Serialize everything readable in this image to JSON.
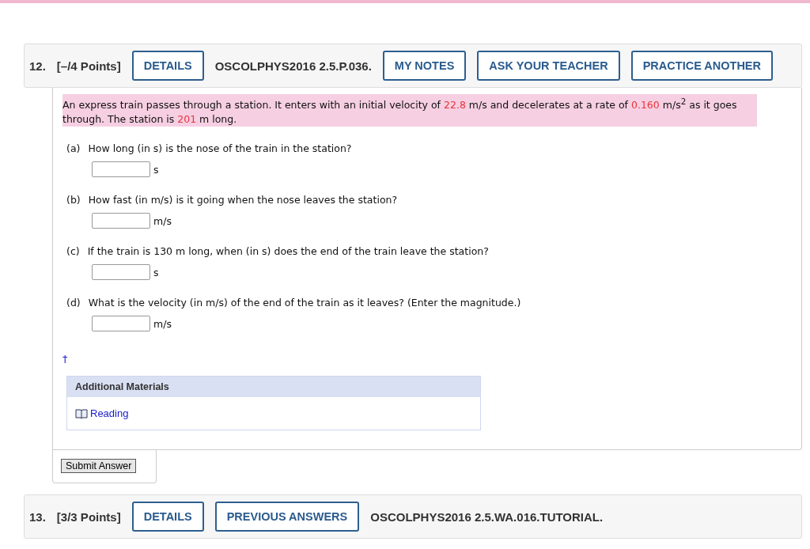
{
  "questions": [
    {
      "number": "12.",
      "points": "[–/4 Points]",
      "items": [
        {
          "kind": "button",
          "label": "DETAILS"
        },
        {
          "kind": "code",
          "label": "OSCOLPHYS2016 2.5.P.036."
        },
        {
          "kind": "button",
          "label": "MY NOTES"
        },
        {
          "kind": "button",
          "label": "ASK YOUR TEACHER"
        },
        {
          "kind": "button",
          "label": "PRACTICE ANOTHER"
        }
      ],
      "problem": [
        {
          "kind": "text",
          "text": "An express train passes through a station. It enters with an initial velocity of "
        },
        {
          "kind": "value",
          "text": "22.8"
        },
        {
          "kind": "text",
          "text": " m/s and decelerates at a rate of "
        },
        {
          "kind": "value",
          "text": "0.160"
        },
        {
          "kind": "text",
          "text": " m/s$^{2}$ as it goes through. The station is "
        },
        {
          "kind": "value",
          "text": "201"
        },
        {
          "kind": "text",
          "text": " m long."
        }
      ],
      "parts": [
        {
          "label": "(a)",
          "question": "How long (in s) is the nose of the train in the station?",
          "unit": "s"
        },
        {
          "label": "(b)",
          "question": "How fast (in m/s) is it going when the nose leaves the station?",
          "unit": "m/s"
        },
        {
          "label": "(c)",
          "question": "If the train is 130 m long, when (in s) does the end of the train leave the station?",
          "unit": "s"
        },
        {
          "label": "(d)",
          "question": "What is the velocity (in m/s) of the end of the train as it leaves? (Enter the magnitude.)",
          "unit": "m/s"
        }
      ],
      "dagger": "†",
      "materials": {
        "title": "Additional Materials",
        "links": [
          "Reading"
        ]
      },
      "submit": "Submit Answer"
    },
    {
      "number": "13.",
      "points": "[3/3 Points]",
      "items": [
        {
          "kind": "button",
          "label": "DETAILS"
        },
        {
          "kind": "button",
          "label": "PREVIOUS ANSWERS"
        },
        {
          "kind": "code",
          "label": "OSCOLPHYS2016 2.5.WA.016.TUTORIAL."
        }
      ]
    }
  ]
}
